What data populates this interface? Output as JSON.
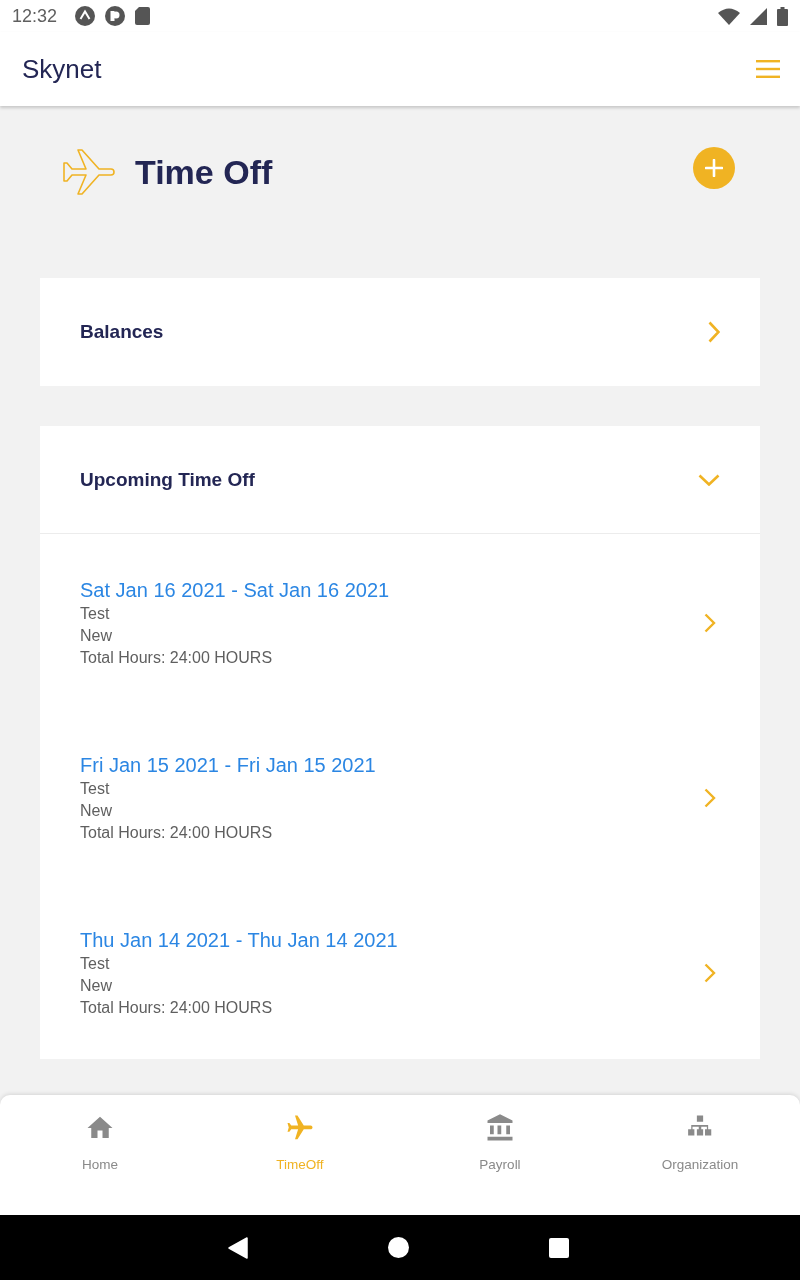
{
  "status_bar": {
    "time": "12:32"
  },
  "app_bar": {
    "title": "Skynet"
  },
  "page": {
    "title": "Time Off"
  },
  "sections": [
    {
      "title": "Balances",
      "expanded": false
    },
    {
      "title": "Upcoming Time Off",
      "expanded": true,
      "items": [
        {
          "dates": "Sat Jan 16 2021 - Sat Jan 16 2021",
          "type": "Test",
          "status": "New",
          "total": "Total Hours: 24:00 HOURS"
        },
        {
          "dates": "Fri Jan 15 2021 - Fri Jan 15 2021",
          "type": "Test",
          "status": "New",
          "total": "Total Hours: 24:00 HOURS"
        },
        {
          "dates": "Thu Jan 14 2021 - Thu Jan 14 2021",
          "type": "Test",
          "status": "New",
          "total": "Total Hours: 24:00 HOURS"
        }
      ]
    }
  ],
  "bottom_nav": [
    {
      "label": "Home",
      "selected": false
    },
    {
      "label": "TimeOff",
      "selected": true
    },
    {
      "label": "Payroll",
      "selected": false
    },
    {
      "label": "Organization",
      "selected": false
    }
  ]
}
